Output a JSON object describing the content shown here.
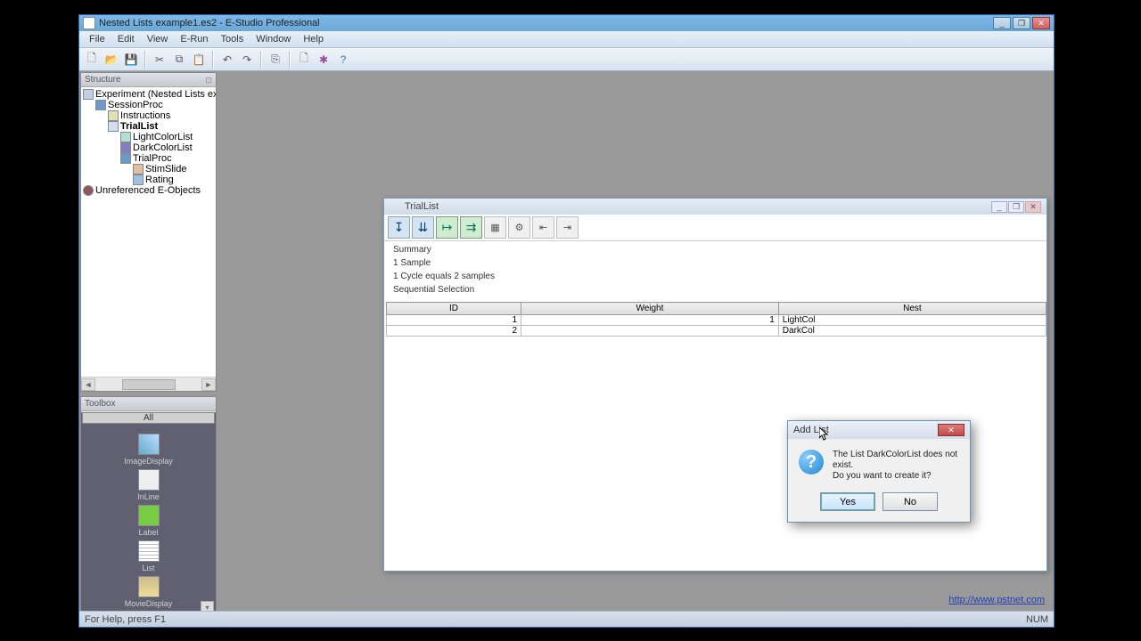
{
  "window": {
    "title": "Nested Lists example1.es2 - E-Studio Professional"
  },
  "menu": {
    "items": [
      "File",
      "Edit",
      "View",
      "E-Run",
      "Tools",
      "Window",
      "Help"
    ]
  },
  "structure": {
    "title": "Structure",
    "nodes": {
      "root": "Experiment (Nested Lists example",
      "session": "SessionProc",
      "instructions": "Instructions",
      "triallist": "TrialList",
      "light": "LightColorList",
      "dark": "DarkColorList",
      "trialproc": "TrialProc",
      "stimslide": "StimSlide",
      "rating": "Rating",
      "unref": "Unreferenced E-Objects"
    }
  },
  "toolbox": {
    "title": "Toolbox",
    "tab": "All",
    "items": [
      "ImageDisplay",
      "InLine",
      "Label",
      "List",
      "MovieDisplay"
    ]
  },
  "triallist": {
    "title": "TrialList",
    "summary": {
      "h": "Summary",
      "l1": "1 Sample",
      "l2": "1 Cycle equals 2 samples",
      "l3": "Sequential Selection"
    },
    "columns": [
      "ID",
      "Weight",
      "Nest"
    ],
    "rows": [
      {
        "id": "1",
        "weight": "1",
        "nested": "LightCol"
      },
      {
        "id": "2",
        "weight": "",
        "nested": "DarkCol"
      }
    ]
  },
  "dialog": {
    "title": "Add List",
    "line1": "The List DarkColorList does not exist.",
    "line2": "Do you want to create it?",
    "yes": "Yes",
    "no": "No"
  },
  "footer": {
    "link": "http://www.pstnet.com"
  },
  "status": {
    "left": "For Help, press F1",
    "right": "NUM"
  }
}
